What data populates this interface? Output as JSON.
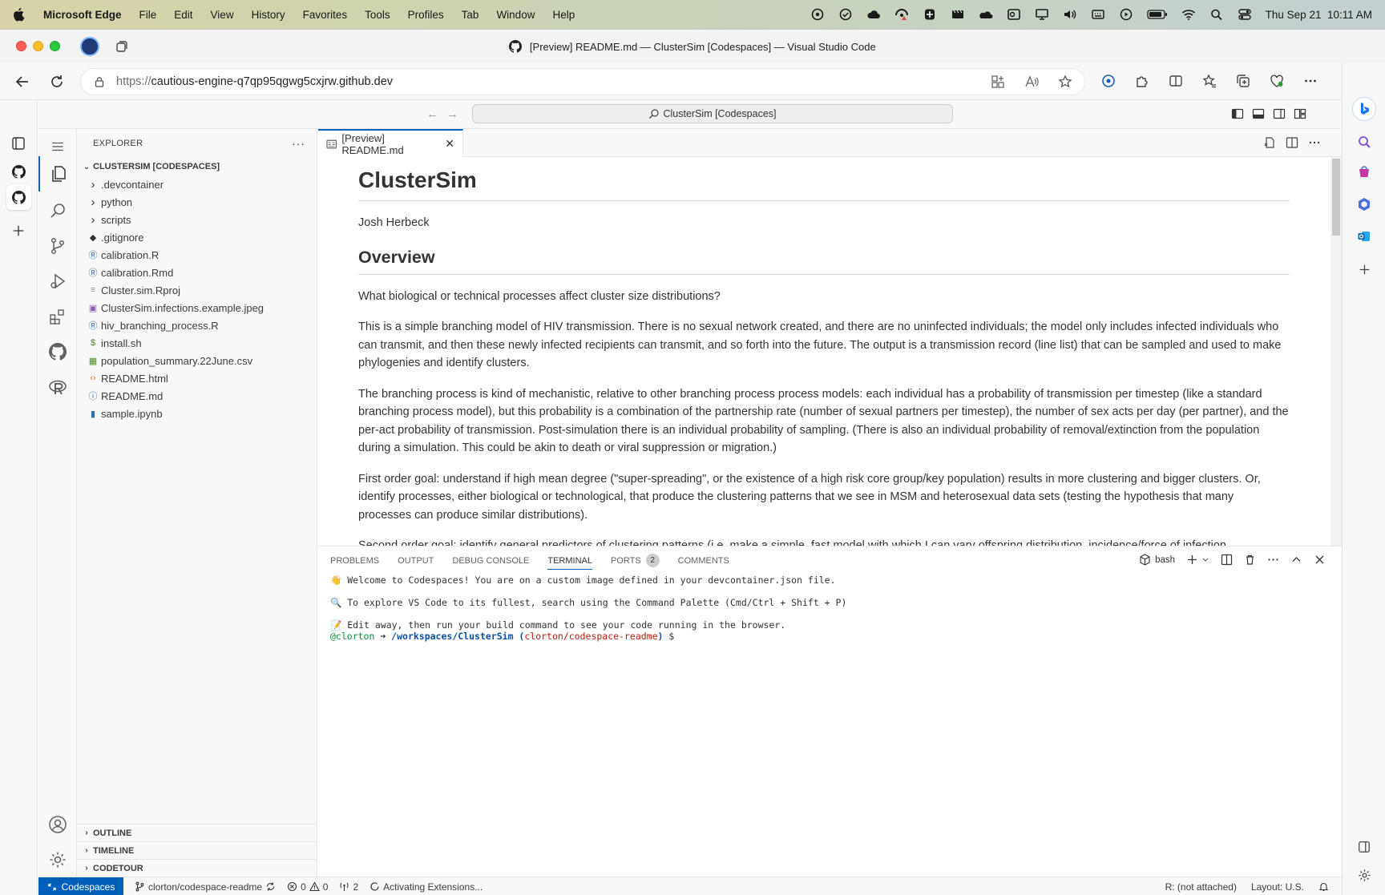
{
  "menubar": {
    "app": "Microsoft Edge",
    "items": [
      "File",
      "Edit",
      "View",
      "History",
      "Favorites",
      "Tools",
      "Profiles",
      "Tab",
      "Window",
      "Help"
    ],
    "datetime": "Thu Sep 21  10:11 AM"
  },
  "window": {
    "title": "[Preview] README.md — ClusterSim [Codespaces] — Visual Studio Code"
  },
  "address": {
    "prefix": "https://",
    "host": "cautious-engine-q7qp95qgwg5cxjrw.github.dev"
  },
  "vscode": {
    "command_center": "ClusterSim [Codespaces]",
    "explorer_title": "EXPLORER",
    "workspace": "CLUSTERSIM [CODESPACES]",
    "tree": [
      {
        "name": ".devcontainer",
        "type": "folder"
      },
      {
        "name": "python",
        "type": "folder"
      },
      {
        "name": "scripts",
        "type": "folder"
      },
      {
        "name": ".gitignore",
        "type": "git"
      },
      {
        "name": "calibration.R",
        "type": "r"
      },
      {
        "name": "calibration.Rmd",
        "type": "r"
      },
      {
        "name": "Cluster.sim.Rproj",
        "type": "lines"
      },
      {
        "name": "ClusterSim.infections.example.jpeg",
        "type": "image"
      },
      {
        "name": "hiv_branching_process.R",
        "type": "r"
      },
      {
        "name": "install.sh",
        "type": "shell"
      },
      {
        "name": "population_summary.22June.csv",
        "type": "csv"
      },
      {
        "name": "README.html",
        "type": "html"
      },
      {
        "name": "README.md",
        "type": "info"
      },
      {
        "name": "sample.ipynb",
        "type": "notebook"
      }
    ],
    "bottom_sections": [
      "OUTLINE",
      "TIMELINE",
      "CODETOUR"
    ],
    "tab_label": "[Preview] README.md",
    "readme": {
      "h1": "ClusterSim",
      "author": "Josh Herbeck",
      "h2": "Overview",
      "paragraphs": [
        "What biological or technical processes affect cluster size distributions?",
        "This is a simple branching model of HIV transmission. There is no sexual network created, and there are no uninfected individuals; the model only includes infected individuals who can transmit, and then these newly infected recipients can transmit, and so forth into the future. The output is a transmission record (line list) that can be sampled and used to make phylogenies and identify clusters.",
        "The branching process is kind of mechanistic, relative to other branching process process models: each individual has a probability of transmission per timestep (like a standard branching process model), but this probability is a combination of the partnership rate (number of sexual partners per timestep), the number of sex acts per day (per partner), and the per-act probability of transmission. Post-simulation there is an individual probability of sampling. (There is also an individual probability of removal/extinction from the population during a simulation. This could be akin to death or viral suppression or migration.)",
        "First order goal: understand if high mean degree (\"super-spreading\", or the existence of a high risk core group/key population) results in more clustering and bigger clusters. Or, identify processes, either biological or technological, that produce the clustering patterns that we see in MSM and heterosexual data sets (testing the hypothesis that many processes can produce similar distributions).",
        "Second order goal: identify general predictors of clustering patterns (i.e. make a simple, fast model with which I can vary offspring distribution, incidence/force of infection,"
      ]
    },
    "panel_tabs": [
      "PROBLEMS",
      "OUTPUT",
      "DEBUG CONSOLE",
      "TERMINAL",
      "PORTS",
      "COMMENTS"
    ],
    "ports_count": "2",
    "shell": "bash",
    "terminal": {
      "line1": "👋 Welcome to Codespaces! You are on a custom image defined in your devcontainer.json file.",
      "line2": "🔍 To explore VS Code to its fullest, search using the Command Palette (Cmd/Ctrl + Shift + P)",
      "line3": "📝 Edit away, then run your build command to see your code running in the browser.",
      "prompt_user": "@clorton",
      "prompt_arrow": " ➜ ",
      "prompt_path": "/workspaces/ClusterSim",
      "prompt_branch_open": " (",
      "prompt_branch": "clorton/codespace-readme",
      "prompt_branch_close": ")",
      "prompt_dollar": " $"
    },
    "status": {
      "remote": "Codespaces",
      "branch": "clorton/codespace-readme",
      "errors": "0",
      "warnings": "0",
      "ports": "2",
      "activity": "Activating Extensions...",
      "r_status": "R: (not attached)",
      "layout": "Layout: U.S."
    }
  }
}
